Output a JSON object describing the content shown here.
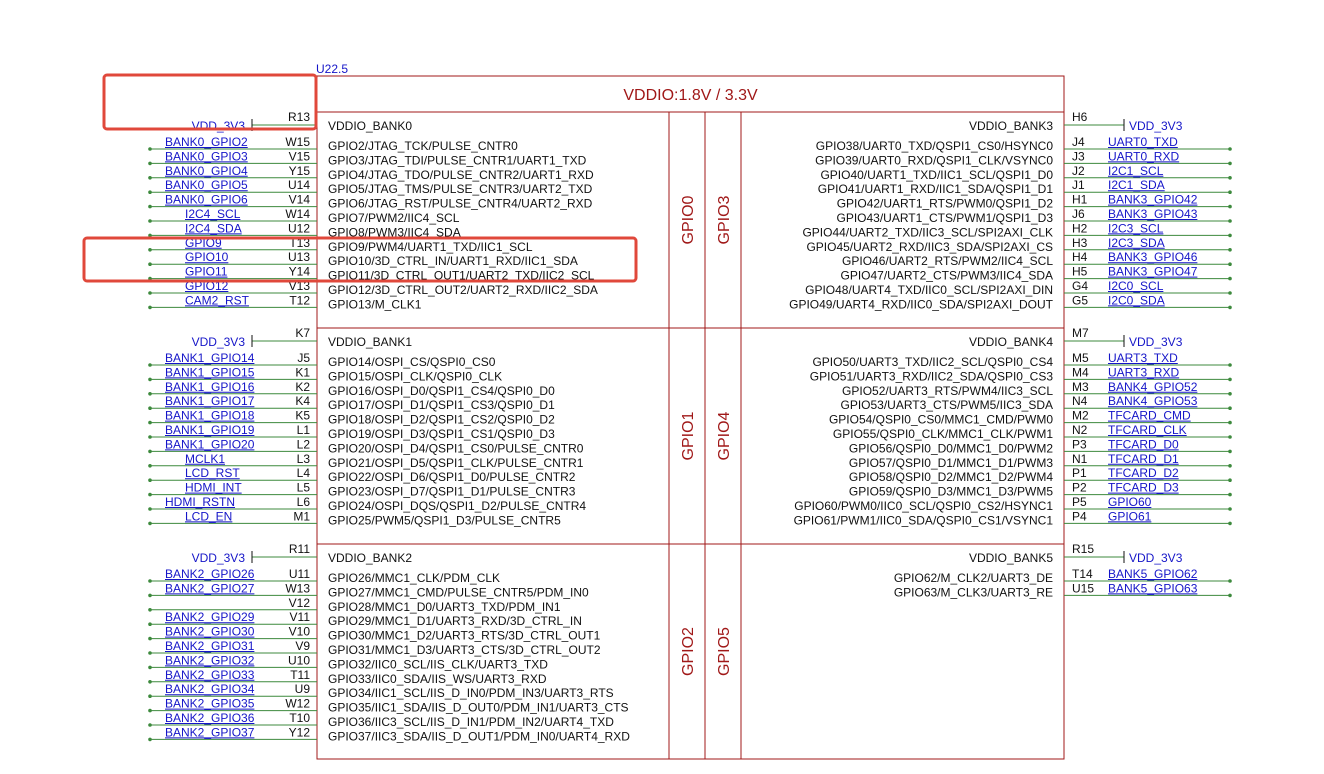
{
  "ref": "U22.5",
  "title": "VDDIO:1.8V / 3.3V",
  "colors": {
    "chip": "#a01818",
    "net": "#1515c8",
    "wire": "#3d8a3d",
    "text": "#111111",
    "highlight": "#e0483b"
  },
  "gpio_labels": [
    "GPIO0",
    "GPIO3",
    "GPIO1",
    "GPIO4",
    "GPIO2",
    "GPIO5"
  ],
  "banks": [
    {
      "left_bank": "VDDIO_BANK0",
      "right_bank": "VDDIO_BANK3",
      "left_power": {
        "net": "VDD_3V3",
        "pin": "R13"
      },
      "right_power": {
        "net": "VDD_3V3",
        "pin": "H6"
      },
      "left": [
        {
          "net": "BANK0_GPIO2",
          "pin": "W15",
          "func": "GPIO2/JTAG_TCK/PULSE_CNTR0"
        },
        {
          "net": "BANK0_GPIO3",
          "pin": "V15",
          "func": "GPIO3/JTAG_TDI/PULSE_CNTR1/UART1_TXD"
        },
        {
          "net": "BANK0_GPIO4",
          "pin": "Y15",
          "func": "GPIO4/JTAG_TDO/PULSE_CNTR2/UART1_RXD"
        },
        {
          "net": "BANK0_GPIO5",
          "pin": "U14",
          "func": "GPIO5/JTAG_TMS/PULSE_CNTR3/UART2_TXD"
        },
        {
          "net": "BANK0_GPIO6",
          "pin": "V14",
          "func": "GPIO6/JTAG_RST/PULSE_CNTR4/UART2_RXD"
        },
        {
          "net": "I2C4_SCL",
          "pin": "W14",
          "func": "GPIO7/PWM2/IIC4_SCL"
        },
        {
          "net": "I2C4_SDA",
          "pin": "U12",
          "func": "GPIO8/PWM3/IIC4_SDA"
        },
        {
          "net": "GPIO9",
          "pin": "T13",
          "func": "GPIO9/PWM4/UART1_TXD/IIC1_SCL"
        },
        {
          "net": "GPIO10",
          "pin": "U13",
          "func": "GPIO10/3D_CTRL_IN/UART1_RXD/IIC1_SDA"
        },
        {
          "net": "GPIO11",
          "pin": "Y14",
          "func": "GPIO11/3D_CTRL_OUT1/UART2_TXD/IIC2_SCL"
        },
        {
          "net": "GPIO12",
          "pin": "V13",
          "func": "GPIO12/3D_CTRL_OUT2/UART2_RXD/IIC2_SDA"
        },
        {
          "net": "CAM2_RST",
          "pin": "T12",
          "func": "GPIO13/M_CLK1"
        }
      ],
      "right": [
        {
          "net": "UART0_TXD",
          "pin": "J4",
          "func": "GPIO38/UART0_TXD/QSPI1_CS0/HSYNC0"
        },
        {
          "net": "UART0_RXD",
          "pin": "J3",
          "func": "GPIO39/UART0_RXD/QSPI1_CLK/VSYNC0"
        },
        {
          "net": "I2C1_SCL",
          "pin": "J2",
          "func": "GPIO40/UART1_TXD/IIC1_SCL/QSPI1_D0"
        },
        {
          "net": "I2C1_SDA",
          "pin": "J1",
          "func": "GPIO41/UART1_RXD/IIC1_SDA/QSPI1_D1"
        },
        {
          "net": "BANK3_GPIO42",
          "pin": "H1",
          "func": "GPIO42/UART1_RTS/PWM0/QSPI1_D2"
        },
        {
          "net": "BANK3_GPIO43",
          "pin": "J6",
          "func": "GPIO43/UART1_CTS/PWM1/QSPI1_D3"
        },
        {
          "net": "I2C3_SCL",
          "pin": "H2",
          "func": "GPIO44/UART2_TXD/IIC3_SCL/SPI2AXI_CLK"
        },
        {
          "net": "I2C3_SDA",
          "pin": "H3",
          "func": "GPIO45/UART2_RXD/IIC3_SDA/SPI2AXI_CS"
        },
        {
          "net": "BANK3_GPIO46",
          "pin": "H4",
          "func": "GPIO46/UART2_RTS/PWM2/IIC4_SCL"
        },
        {
          "net": "BANK3_GPIO47",
          "pin": "H5",
          "func": "GPIO47/UART2_CTS/PWM3/IIC4_SDA"
        },
        {
          "net": "I2C0_SCL",
          "pin": "G4",
          "func": "GPIO48/UART4_TXD/IIC0_SCL/SPI2AXI_DIN"
        },
        {
          "net": "I2C0_SDA",
          "pin": "G5",
          "func": "GPIO49/UART4_RXD/IIC0_SDA/SPI2AXI_DOUT"
        }
      ]
    },
    {
      "left_bank": "VDDIO_BANK1",
      "right_bank": "VDDIO_BANK4",
      "left_power": {
        "net": "VDD_3V3",
        "pin": "K7"
      },
      "right_power": {
        "net": "VDD_3V3",
        "pin": "M7"
      },
      "left": [
        {
          "net": "BANK1_GPIO14",
          "pin": "J5",
          "func": "GPIO14/OSPI_CS/QSPI0_CS0"
        },
        {
          "net": "BANK1_GPIO15",
          "pin": "K1",
          "func": "GPIO15/OSPI_CLK/QSPI0_CLK"
        },
        {
          "net": "BANK1_GPIO16",
          "pin": "K2",
          "func": "GPIO16/OSPI_D0/QSPI1_CS4/QSPI0_D0"
        },
        {
          "net": "BANK1_GPIO17",
          "pin": "K4",
          "func": "GPIO17/OSPI_D1/QSPI1_CS3/QSPI0_D1"
        },
        {
          "net": "BANK1_GPIO18",
          "pin": "K5",
          "func": "GPIO18/OSPI_D2/QSPI1_CS2/QSPI0_D2"
        },
        {
          "net": "BANK1_GPIO19",
          "pin": "L1",
          "func": "GPIO19/OSPI_D3/QSPI1_CS1/QSPI0_D3"
        },
        {
          "net": "BANK1_GPIO20",
          "pin": "L2",
          "func": "GPIO20/OSPI_D4/QSPI1_CS0/PULSE_CNTR0"
        },
        {
          "net": "MCLK1",
          "pin": "L3",
          "func": "GPIO21/OSPI_D5/QSPI1_CLK/PULSE_CNTR1"
        },
        {
          "net": "LCD_RST",
          "pin": "L4",
          "func": "GPIO22/OSPI_D6/QSPI1_D0/PULSE_CNTR2"
        },
        {
          "net": "HDMI_INT",
          "pin": "L5",
          "func": "GPIO23/OSPI_D7/QSPI1_D1/PULSE_CNTR3"
        },
        {
          "net": "HDMI_RSTN",
          "pin": "L6",
          "func": "GPIO24/OSPI_DQS/QSPI1_D2/PULSE_CNTR4"
        },
        {
          "net": "LCD_EN",
          "pin": "M1",
          "func": "GPIO25/PWM5/QSPI1_D3/PULSE_CNTR5"
        }
      ],
      "right": [
        {
          "net": "UART3_TXD",
          "pin": "M5",
          "func": "GPIO50/UART3_TXD/IIC2_SCL/QSPI0_CS4"
        },
        {
          "net": "UART3_RXD",
          "pin": "M4",
          "func": "GPIO51/UART3_RXD/IIC2_SDA/QSPI0_CS3"
        },
        {
          "net": "BANK4_GPIO52",
          "pin": "M3",
          "func": "GPIO52/UART3_RTS/PWM4/IIC3_SCL"
        },
        {
          "net": "BANK4_GPIO53",
          "pin": "N4",
          "func": "GPIO53/UART3_CTS/PWM5/IIC3_SDA"
        },
        {
          "net": "TFCARD_CMD",
          "pin": "M2",
          "func": "GPIO54/QSPI0_CS0/MMC1_CMD/PWM0"
        },
        {
          "net": "TFCARD_CLK",
          "pin": "N2",
          "func": "GPIO55/QSPI0_CLK/MMC1_CLK/PWM1"
        },
        {
          "net": "TFCARD_D0",
          "pin": "P3",
          "func": "GPIO56/QSPI0_D0/MMC1_D0/PWM2"
        },
        {
          "net": "TFCARD_D1",
          "pin": "N1",
          "func": "GPIO57/QSPI0_D1/MMC1_D1/PWM3"
        },
        {
          "net": "TFCARD_D2",
          "pin": "P1",
          "func": "GPIO58/QSPI0_D2/MMC1_D2/PWM4"
        },
        {
          "net": "TFCARD_D3",
          "pin": "P2",
          "func": "GPIO59/QSPI0_D3/MMC1_D3/PWM5"
        },
        {
          "net": "GPIO60",
          "pin": "P5",
          "func": "GPIO60/PWM0/IIC0_SCL/QSPI0_CS2/HSYNC1"
        },
        {
          "net": "GPIO61",
          "pin": "P4",
          "func": "GPIO61/PWM1/IIC0_SDA/QSPI0_CS1/VSYNC1"
        }
      ]
    },
    {
      "left_bank": "VDDIO_BANK2",
      "right_bank": "VDDIO_BANK5",
      "left_power": {
        "net": "VDD_3V3",
        "pin": "R11"
      },
      "right_power": {
        "net": "VDD_3V3",
        "pin": "R15"
      },
      "left": [
        {
          "net": "BANK2_GPIO26",
          "pin": "U11",
          "func": "GPIO26/MMC1_CLK/PDM_CLK"
        },
        {
          "net": "BANK2_GPIO27",
          "pin": "W13",
          "func": "GPIO27/MMC1_CMD/PULSE_CNTR5/PDM_IN0"
        },
        {
          "net": "",
          "pin": "V12",
          "func": "GPIO28/MMC1_D0/UART3_TXD/PDM_IN1"
        },
        {
          "net": "BANK2_GPIO29",
          "pin": "V11",
          "func": "GPIO29/MMC1_D1/UART3_RXD/3D_CTRL_IN"
        },
        {
          "net": "BANK2_GPIO30",
          "pin": "V10",
          "func": "GPIO30/MMC1_D2/UART3_RTS/3D_CTRL_OUT1"
        },
        {
          "net": "BANK2_GPIO31",
          "pin": "V9",
          "func": "GPIO31/MMC1_D3/UART3_CTS/3D_CTRL_OUT2"
        },
        {
          "net": "BANK2_GPIO32",
          "pin": "U10",
          "func": "GPIO32/IIC0_SCL/IIS_CLK/UART3_TXD"
        },
        {
          "net": "BANK2_GPIO33",
          "pin": "T11",
          "func": "GPIO33/IIC0_SDA/IIS_WS/UART3_RXD"
        },
        {
          "net": "BANK2_GPIO34",
          "pin": "U9",
          "func": "GPIO34/IIC1_SCL/IIS_D_IN0/PDM_IN3/UART3_RTS"
        },
        {
          "net": "BANK2_GPIO35",
          "pin": "W12",
          "func": "GPIO35/IIC1_SDA/IIS_D_OUT0/PDM_IN1/UART3_CTS"
        },
        {
          "net": "BANK2_GPIO36",
          "pin": "T10",
          "func": "GPIO36/IIC3_SCL/IIS_D_IN1/PDM_IN2/UART4_TXD"
        },
        {
          "net": "BANK2_GPIO37",
          "pin": "Y12",
          "func": "GPIO37/IIC3_SDA/IIS_D_OUT1/PDM_IN0/UART4_RXD"
        }
      ],
      "right": [
        {
          "net": "BANK5_GPIO62",
          "pin": "T14",
          "func": "GPIO62/M_CLK2/UART3_DE"
        },
        {
          "net": "BANK5_GPIO63",
          "pin": "U15",
          "func": "GPIO63/M_CLK3/UART3_RE"
        }
      ]
    }
  ]
}
